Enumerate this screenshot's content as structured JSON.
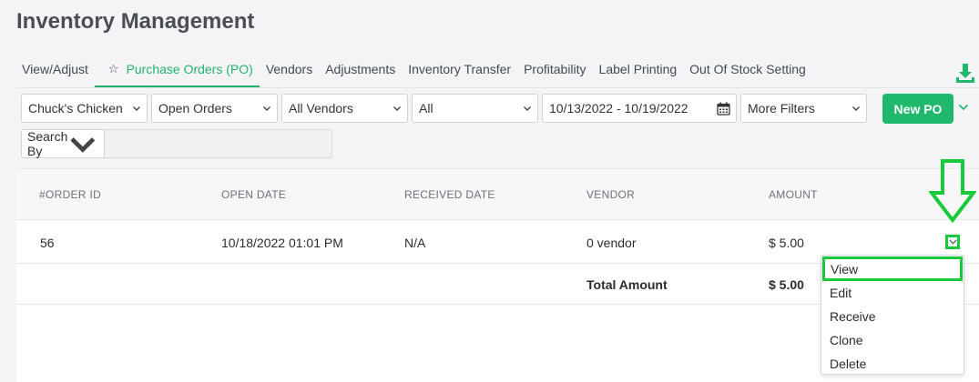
{
  "page": {
    "title": "Inventory Management"
  },
  "tabs": [
    {
      "label": "View/Adjust"
    },
    {
      "label": "Purchase Orders (PO)",
      "active": true
    },
    {
      "label": "Vendors"
    },
    {
      "label": "Adjustments"
    },
    {
      "label": "Inventory Transfer"
    },
    {
      "label": "Profitability"
    },
    {
      "label": "Label Printing"
    },
    {
      "label": "Out Of Stock Setting"
    }
  ],
  "filters": {
    "store": "Chuck's Chicken",
    "order_status": "Open Orders",
    "vendor": "All Vendors",
    "type": "All",
    "date_range": "10/13/2022 - 10/19/2022",
    "more": "More Filters",
    "new_po_label": "New PO",
    "search_by": "Search By",
    "search_value": ""
  },
  "table": {
    "columns": [
      "#ORDER ID",
      "OPEN DATE",
      "RECEIVED DATE",
      "VENDOR",
      "AMOUNT"
    ],
    "rows": [
      {
        "order_id": "56",
        "open_date": "10/18/2022 01:01 PM",
        "received_date": "N/A",
        "vendor": "0 vendor",
        "amount": "$ 5.00"
      }
    ],
    "total_label": "Total Amount",
    "total_amount": "$ 5.00"
  },
  "row_menu": {
    "items": [
      "View",
      "Edit",
      "Receive",
      "Clone",
      "Delete"
    ],
    "highlighted": "View"
  },
  "colors": {
    "accent": "#21b36b",
    "button": "#20b86a",
    "annotation": "#19c93c"
  },
  "icons": {
    "download": "download-icon",
    "calendar": "calendar-icon",
    "chevron": "chevron-down-icon",
    "star": "star-icon",
    "annotation_arrow": "arrow-down-icon"
  }
}
